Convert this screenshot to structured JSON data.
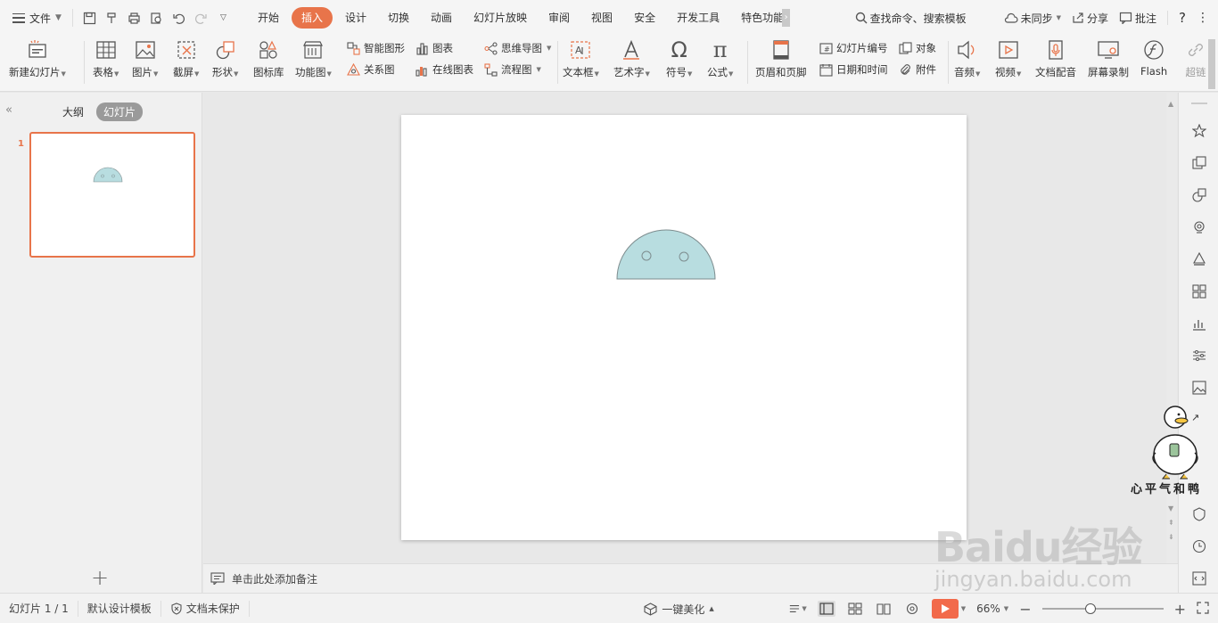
{
  "menu": {
    "file_label": "文件",
    "tabs": [
      "开始",
      "插入",
      "设计",
      "切换",
      "动画",
      "幻灯片放映",
      "审阅",
      "视图",
      "安全",
      "开发工具",
      "特色功能"
    ],
    "active_tab": "插入",
    "search_label": "查找命令、搜索模板",
    "sync_label": "未同步",
    "share_label": "分享",
    "comment_label": "批注",
    "help_label": "?"
  },
  "ribbon": {
    "new_slide": "新建幻灯片",
    "table": "表格",
    "picture": "图片",
    "screenshot": "截屏",
    "shape": "形状",
    "icon_lib": "图标库",
    "func_chart": "功能图",
    "smart_shape": "智能图形",
    "chart": "图表",
    "relation": "关系图",
    "online_chart": "在线图表",
    "mindmap": "思维导图",
    "flowchart": "流程图",
    "textbox": "文本框",
    "wordart": "艺术字",
    "symbol": "符号",
    "formula": "公式",
    "header_footer": "页眉和页脚",
    "slide_number": "幻灯片编号",
    "object": "对象",
    "datetime": "日期和时间",
    "attachment": "附件",
    "audio": "音频",
    "video": "视频",
    "doc_dub": "文档配音",
    "screen_record": "屏幕录制",
    "flash": "Flash",
    "hyperlink": "超链"
  },
  "left_panel": {
    "outline_tab": "大纲",
    "slides_tab": "幻灯片",
    "slide_number": "1"
  },
  "notes": {
    "placeholder": "单击此处添加备注"
  },
  "status": {
    "slide_info": "幻灯片 1 / 1",
    "template": "默认设计模板",
    "protection": "文档未保护",
    "beautify": "一键美化",
    "zoom": "66%",
    "zoom_fraction": 0.4
  },
  "watermark": {
    "logo": "Baidu经验",
    "url": "jingyan.baidu.com",
    "sticker_text": "心平气和鸭"
  },
  "colors": {
    "accent": "#e8744a",
    "shape_fill": "#b8dde0",
    "shape_stroke": "#7d8c8e",
    "play": "#f26a4b"
  }
}
